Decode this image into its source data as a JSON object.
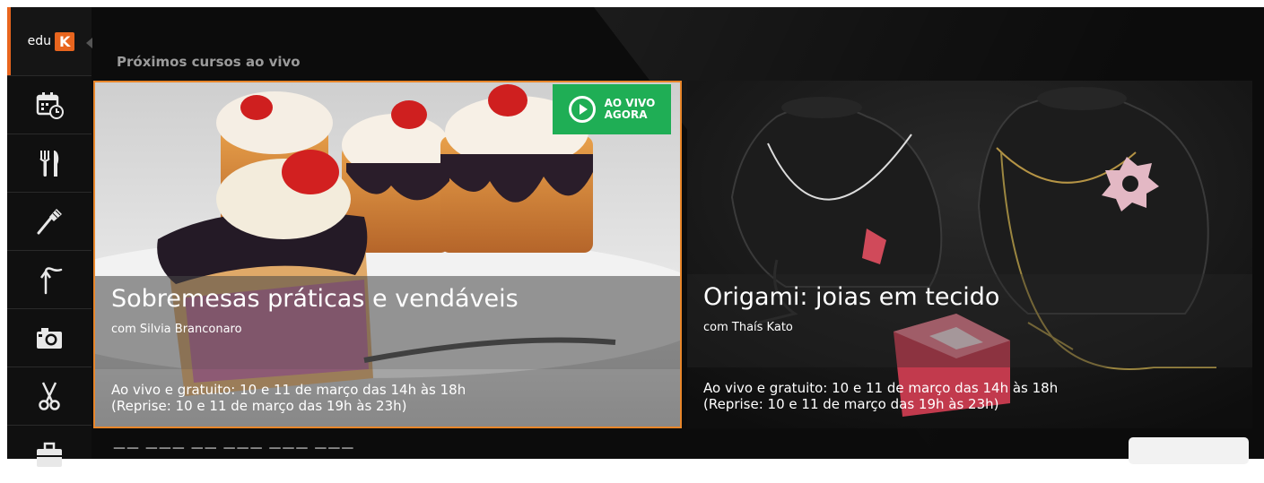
{
  "app": {
    "logo_text": "edu",
    "logo_badge": "K"
  },
  "sidebar": {
    "items": [
      {
        "icon": "calendar-clock-icon"
      },
      {
        "icon": "fork-knife-icon"
      },
      {
        "icon": "brush-icon"
      },
      {
        "icon": "fishing-rod-icon"
      },
      {
        "icon": "camera-icon"
      },
      {
        "icon": "scissors-icon"
      },
      {
        "icon": "briefcase-icon"
      }
    ]
  },
  "section": {
    "title": "Próximos cursos ao vivo"
  },
  "courses": [
    {
      "title": "Sobremesas práticas e vendáveis",
      "author": "com Silvia Branconaro",
      "info_line1": "Ao vivo e gratuito: 10 e 11 de março das 14h às 18h",
      "info_line2": "(Reprise: 10 e 11 de março das 19h às 23h)",
      "badge_line1": "AO VIVO",
      "badge_line2": "AGORA",
      "selected": true
    },
    {
      "title": "Origami: joias em tecido",
      "author": "com Thaís Kato",
      "info_line1": "Ao vivo e gratuito: 10 e 11 de março das 14h às 18h",
      "info_line2": "(Reprise: 10 e 11 de março das 19h às 23h)"
    }
  ],
  "colors": {
    "accent": "#e8651e",
    "live": "#1fae55",
    "selected_border": "#e8862a"
  }
}
